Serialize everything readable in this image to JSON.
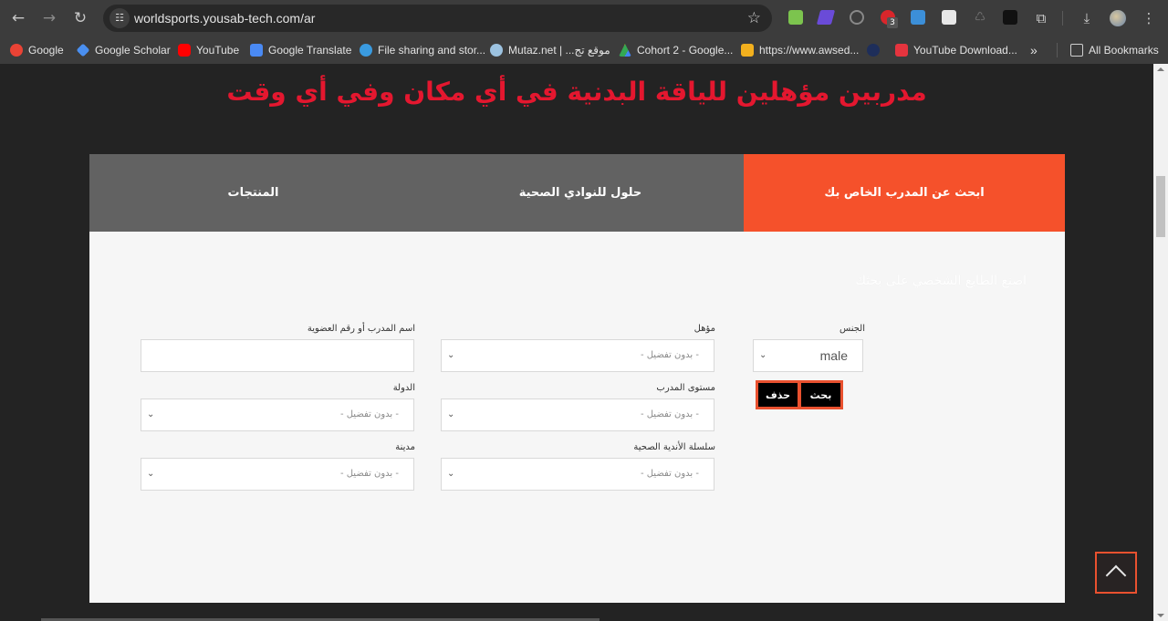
{
  "browser": {
    "url": "worldsports.yousab-tech.com/ar",
    "site_info_icon": "tune-icon",
    "extensions": [
      {
        "name": "green-extension",
        "color": "#7cc44e"
      },
      {
        "name": "purple-check-extension",
        "color": "#6a4bd8"
      },
      {
        "name": "link-extension",
        "color": "#888888"
      },
      {
        "name": "red-extension",
        "color": "#d9262b",
        "badge": "3"
      },
      {
        "name": "fi-extension",
        "color": "#3c8fd8"
      },
      {
        "name": "tab-extension",
        "color": "#e8e8e8"
      },
      {
        "name": "recycle-extension",
        "color": "#6a6a6a"
      },
      {
        "name": "dark-extension",
        "color": "#111111"
      }
    ],
    "bookmarks": [
      {
        "label": "Google",
        "icon_color": "#ea4335"
      },
      {
        "label": "Google Scholar",
        "icon_color": "#4a8ff0"
      },
      {
        "label": "YouTube",
        "icon_color": "#ff0000"
      },
      {
        "label": "Google Translate",
        "icon_color": "#4a8af4"
      },
      {
        "label": "File sharing and stor...",
        "icon_color": "#3a9be0"
      },
      {
        "label": "Mutaz.net | ...موقع تج",
        "icon_color": "#9cc2e0"
      },
      {
        "label": "Cohort 2 - Google...",
        "icon_color": "#fbbc04"
      },
      {
        "label": "https://www.awsed...",
        "icon_color": "#f2b01e"
      },
      {
        "label": "",
        "icon_color": "#1e2e5a"
      },
      {
        "label": "YouTube Download...",
        "icon_color": "#e5343e"
      }
    ],
    "more_bookmarks": "»",
    "all_bookmarks": "All Bookmarks"
  },
  "page": {
    "headline": "مدربين مؤهلين للياقة البدنية في أي مكان وفي أي وقت",
    "tabs": [
      {
        "label": "ابحث عن المدرب الخاص بك",
        "active": true
      },
      {
        "label": "حلول للنوادي الصحية",
        "active": false
      },
      {
        "label": "المنتجات",
        "active": false
      }
    ],
    "subtitle": "اصنع الطابع الشخصي على بحثك",
    "form": {
      "gender": {
        "label": "الجنس",
        "value": "male"
      },
      "qualification": {
        "label": "مؤهل",
        "value": "- بدون تفضيل -"
      },
      "trainer_name": {
        "label": "اسم المدرب أو رقم العضوية",
        "value": "",
        "placeholder": ""
      },
      "trainer_level": {
        "label": "مستوى المدرب",
        "value": "- بدون تفضيل -"
      },
      "country": {
        "label": "الدولة",
        "value": "- بدون تفضيل -"
      },
      "health_clubs_chain": {
        "label": "سلسلة الأندية الصحية",
        "value": "- بدون تفضيل -"
      },
      "city": {
        "label": "مدينة",
        "value": "- بدون تفضيل -"
      },
      "search_button": "بحث",
      "delete_button": "حذف"
    },
    "colors": {
      "accent": "#f5512b",
      "headline": "#e4172f",
      "tab_inactive": "#626262"
    }
  }
}
